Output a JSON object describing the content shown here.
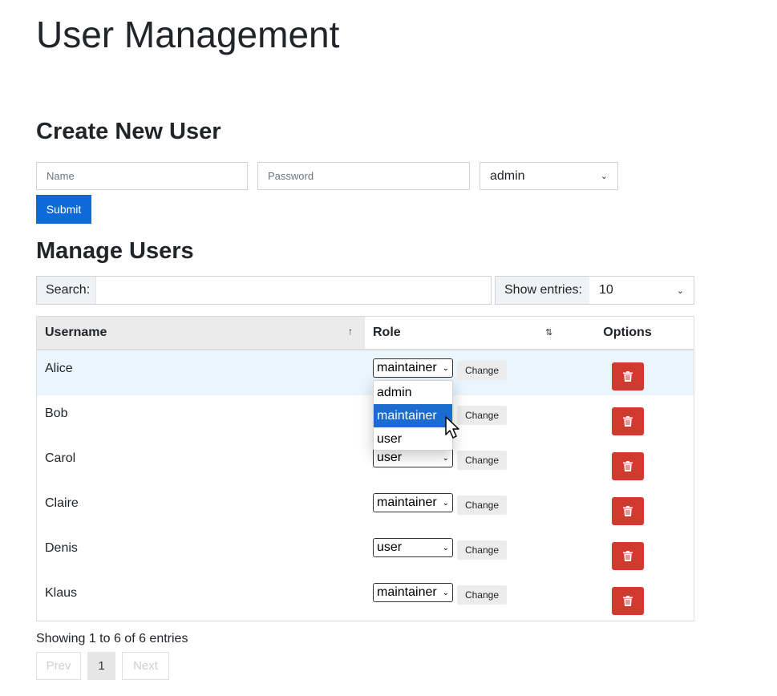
{
  "page": {
    "title": "User Management"
  },
  "create": {
    "heading": "Create New User",
    "name_placeholder": "Name",
    "password_placeholder": "Password",
    "role_value": "admin",
    "submit_label": "Submit"
  },
  "manage": {
    "heading": "Manage Users",
    "search_label": "Search:",
    "entries_label": "Show entries:",
    "entries_value": "10"
  },
  "table": {
    "headers": {
      "username": "Username",
      "role": "Role",
      "options": "Options"
    },
    "sort_icons": {
      "username": "↑",
      "role": "⇅"
    },
    "change_label": "Change",
    "rows": [
      {
        "username": "Alice",
        "role": "maintainer"
      },
      {
        "username": "Bob",
        "role": "maintainer"
      },
      {
        "username": "Carol",
        "role": "user"
      },
      {
        "username": "Claire",
        "role": "maintainer"
      },
      {
        "username": "Denis",
        "role": "user"
      },
      {
        "username": "Klaus",
        "role": "maintainer"
      }
    ]
  },
  "dropdown": {
    "options": [
      "admin",
      "maintainer",
      "user"
    ],
    "highlighted": "maintainer"
  },
  "footer": {
    "showing": "Showing 1 to 6 of 6 entries",
    "prev": "Prev",
    "page": "1",
    "next": "Next"
  },
  "icons": {
    "delete": "trash-icon",
    "cursor": "mouse-pointer-icon",
    "chevron": "chevron-down-icon"
  },
  "colors": {
    "primary": "#0d6ad9",
    "danger": "#d03a2f",
    "row_highlight": "#eaf5fd",
    "option_highlight": "#1b6bd0"
  }
}
